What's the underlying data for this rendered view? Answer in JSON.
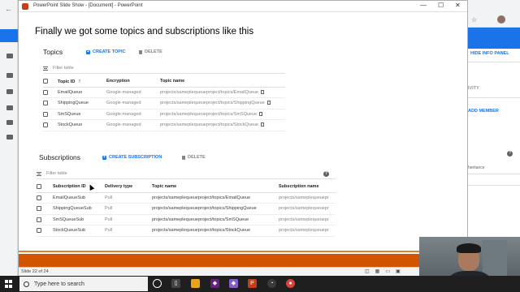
{
  "window": {
    "title": "PowerPoint Slide Show - [Document] - PowerPoint",
    "controls": [
      "—",
      "☐",
      "✕"
    ]
  },
  "slide": {
    "title": "Finally we got some topics and subscriptions like this",
    "topics": {
      "heading": "Topics",
      "create_label": "CREATE TOPIC",
      "delete_label": "DELETE",
      "filter_placeholder": "Filter table",
      "columns": [
        "Topic ID",
        "Encryption",
        "Topic name"
      ],
      "rows": [
        {
          "id": "EmailQueue",
          "encryption": "Google-managed",
          "name": "projects/sameplequeueproject/topics/EmailQueue"
        },
        {
          "id": "ShippingQueue",
          "encryption": "Google-managed",
          "name": "projects/sameplequeueproject/topics/ShippingQueue"
        },
        {
          "id": "SmSQueue",
          "encryption": "Google-managed",
          "name": "projects/sameplequeueproject/topics/SmSQueue"
        },
        {
          "id": "StockQueue",
          "encryption": "Google-managed",
          "name": "projects/sameplequeueproject/topics/StockQueue"
        }
      ]
    },
    "subscriptions": {
      "heading": "Subscriptions",
      "create_label": "CREATE SUBSCRIPTION",
      "delete_label": "DELETE",
      "filter_placeholder": "Filter table",
      "columns": [
        "Subscription ID",
        "Delivery type",
        "Topic name",
        "Subscription name"
      ],
      "rows": [
        {
          "id": "EmailQueueSub",
          "delivery": "Pull",
          "topic": "projects/sameplequeueproject/topics/EmailQueue",
          "sub": "projects/sameplequeuepr"
        },
        {
          "id": "ShippingQueueSub",
          "delivery": "Pull",
          "topic": "projects/sameplequeueproject/topics/ShippingQueue",
          "sub": "projects/sameplequeuepr"
        },
        {
          "id": "SmSQueueSub",
          "delivery": "Pull",
          "topic": "projects/sameplequeueproject/topics/SmSQueue",
          "sub": "projects/sameplequeuepr"
        },
        {
          "id": "StockQueueSub",
          "delivery": "Pull",
          "topic": "projects/sameplequeueproject/topics/StockQueue",
          "sub": "projects/sameplequeuepr"
        }
      ]
    }
  },
  "status_bar": {
    "slide_indicator": "Slide 22 of 24"
  },
  "background_console": {
    "hide_info_panel": "HIDE INFO PANEL",
    "activity": "IVITY",
    "add_member": "ADD MEMBER",
    "inheritance": "heritance"
  },
  "taskbar": {
    "search_placeholder": "Type here to search"
  },
  "colors": {
    "accent": "#1a73e8",
    "slide_band": "#d35400",
    "taskbar": "#1f1f1f"
  }
}
